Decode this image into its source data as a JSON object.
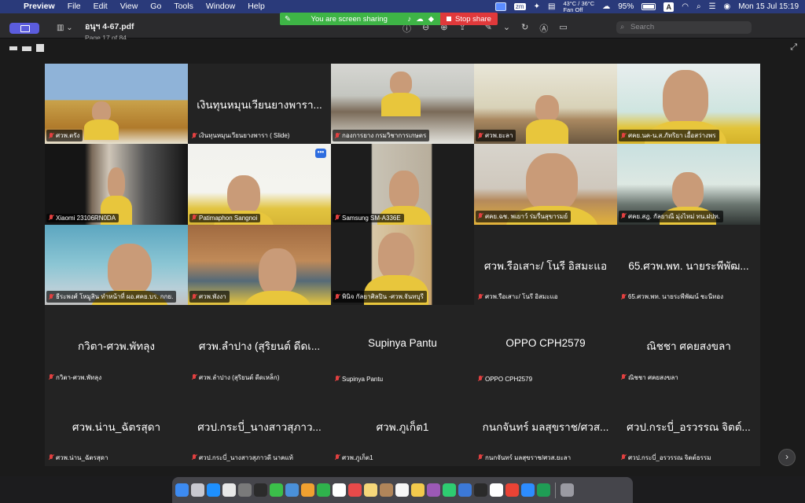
{
  "menubar": {
    "app_name": "Preview",
    "menus": [
      "File",
      "Edit",
      "View",
      "Go",
      "Tools",
      "Window",
      "Help"
    ],
    "temperature": "43°C / 36°C",
    "fan": "Fan Off",
    "battery": "95%",
    "input_source": "A",
    "datetime": "Mon 15 Jul  15:19"
  },
  "share_banner": {
    "message": "You are screen sharing",
    "stop_label": "Stop share"
  },
  "toolbar": {
    "document_name": "อนุฯ 4-67.pdf",
    "page_info": "Page 17 of 84",
    "search_placeholder": "Search"
  },
  "participants": [
    {
      "name": "ศวพ.ตรัง",
      "video": true,
      "muted": true
    },
    {
      "name": "เงินทุนหมุนเวียนยางพารา ( Slide)",
      "display": "เงินทุนหมุนเวียนยางพารา ( Slide)",
      "video": false,
      "muted": true
    },
    {
      "name": "กองการยาง กรมวิชาการเกษตร",
      "video": true,
      "muted": true
    },
    {
      "name": "ศวพ.ยะลา",
      "video": true,
      "muted": true
    },
    {
      "name": "ศคย.นค-น.ส.ภัทริยา เอื้อสว่างพร",
      "video": true,
      "muted": true
    },
    {
      "name": "Xiaomi 23106RN0DA",
      "video": true,
      "muted": true
    },
    {
      "name": "Patimaphon Sangnoi",
      "video": true,
      "muted": true,
      "has_more": true
    },
    {
      "name": "Samsung SM-A336E",
      "video": true,
      "muted": true
    },
    {
      "name": "ศคย.ฉช. พเยาว์ ร่มรื่นสุขารมย์",
      "video": true,
      "muted": true,
      "speaking": true
    },
    {
      "name": "ศคย.สฎ. กัลยาณี มุ่งไหม่  ทน.ฝปท.",
      "video": true,
      "muted": true
    },
    {
      "name": "ธีระพงศ์ โหมูสิน ทำหน้าที่ ผอ.ศคย.บร. กกย.",
      "video": true,
      "muted": true
    },
    {
      "name": "ศวพ.พังงา",
      "video": true,
      "muted": true
    },
    {
      "name": "พินิจ กัลยาศิลปิน -ศวพ.จันทบุรี",
      "video": true,
      "muted": true
    },
    {
      "name": "ศวพ.รือเสาะ/ โนรี อิสมะแอ",
      "display": "ศวพ.รือเสาะ/ โนรี อิสมะแอ",
      "video": false,
      "muted": true
    },
    {
      "name": "65.ศวพ.พท. นายระพีพัฒน์ ชะนีทอง",
      "display": "65.ศวพ.พท. นายระพีพัฒ...",
      "video": false,
      "muted": true
    },
    {
      "name": "กวิตา-ศวพ.พัทลุง",
      "display": "กวิตา-ศวพ.พัทลุง",
      "video": false,
      "muted": true
    },
    {
      "name": "ศวพ.ลำปาง (สุริยนต์ ดีดเหล็ก)",
      "display": "ศวพ.ลำปาง (สุริยนต์  ดีดเ...",
      "video": false,
      "muted": true
    },
    {
      "name": "Supinya Pantu",
      "display": "Supinya Pantu",
      "video": false,
      "muted": true
    },
    {
      "name": "OPPO CPH2579",
      "display": "OPPO CPH2579",
      "video": false,
      "muted": true
    },
    {
      "name": "ณิชชา ศคยสงขลา",
      "display": "ณิชชา ศคยสงขลา",
      "video": false,
      "muted": true
    },
    {
      "name": "ศวพ.น่าน_ฉัตรสุดา",
      "display": "ศวพ.น่าน_ฉัตรสุดา",
      "video": false,
      "muted": true
    },
    {
      "name": "ศวป.กระบี่_นางสาวสุภาวดี นาคแท้",
      "display": "ศวป.กระบี่_นางสาวสุภาว...",
      "video": false,
      "muted": true
    },
    {
      "name": "ศวพ.ภูเก็ต1",
      "display": "ศวพ.ภูเก็ต1",
      "video": false,
      "muted": true
    },
    {
      "name": "กนกจันทร์ มลสุขราช/ศวส.ยะลา",
      "display": "กนกจันทร์  มลสุขราช/ศวส...",
      "video": false,
      "muted": true
    },
    {
      "name": "ศวป.กระบี่_อรวรรณ จิตต์ธรรม",
      "display": "ศวป.กระบี่_อรวรรณ จิตต์...",
      "video": false,
      "muted": true
    }
  ],
  "slide_title": "เงินทุนหมุนเวียนยางพารา...",
  "colors": {
    "menubar": "#2a3a7a",
    "share_green": "#3eb446",
    "stop_red": "#e0393b",
    "speaking_border": "#3dd257",
    "tile_bg": "#232323"
  }
}
